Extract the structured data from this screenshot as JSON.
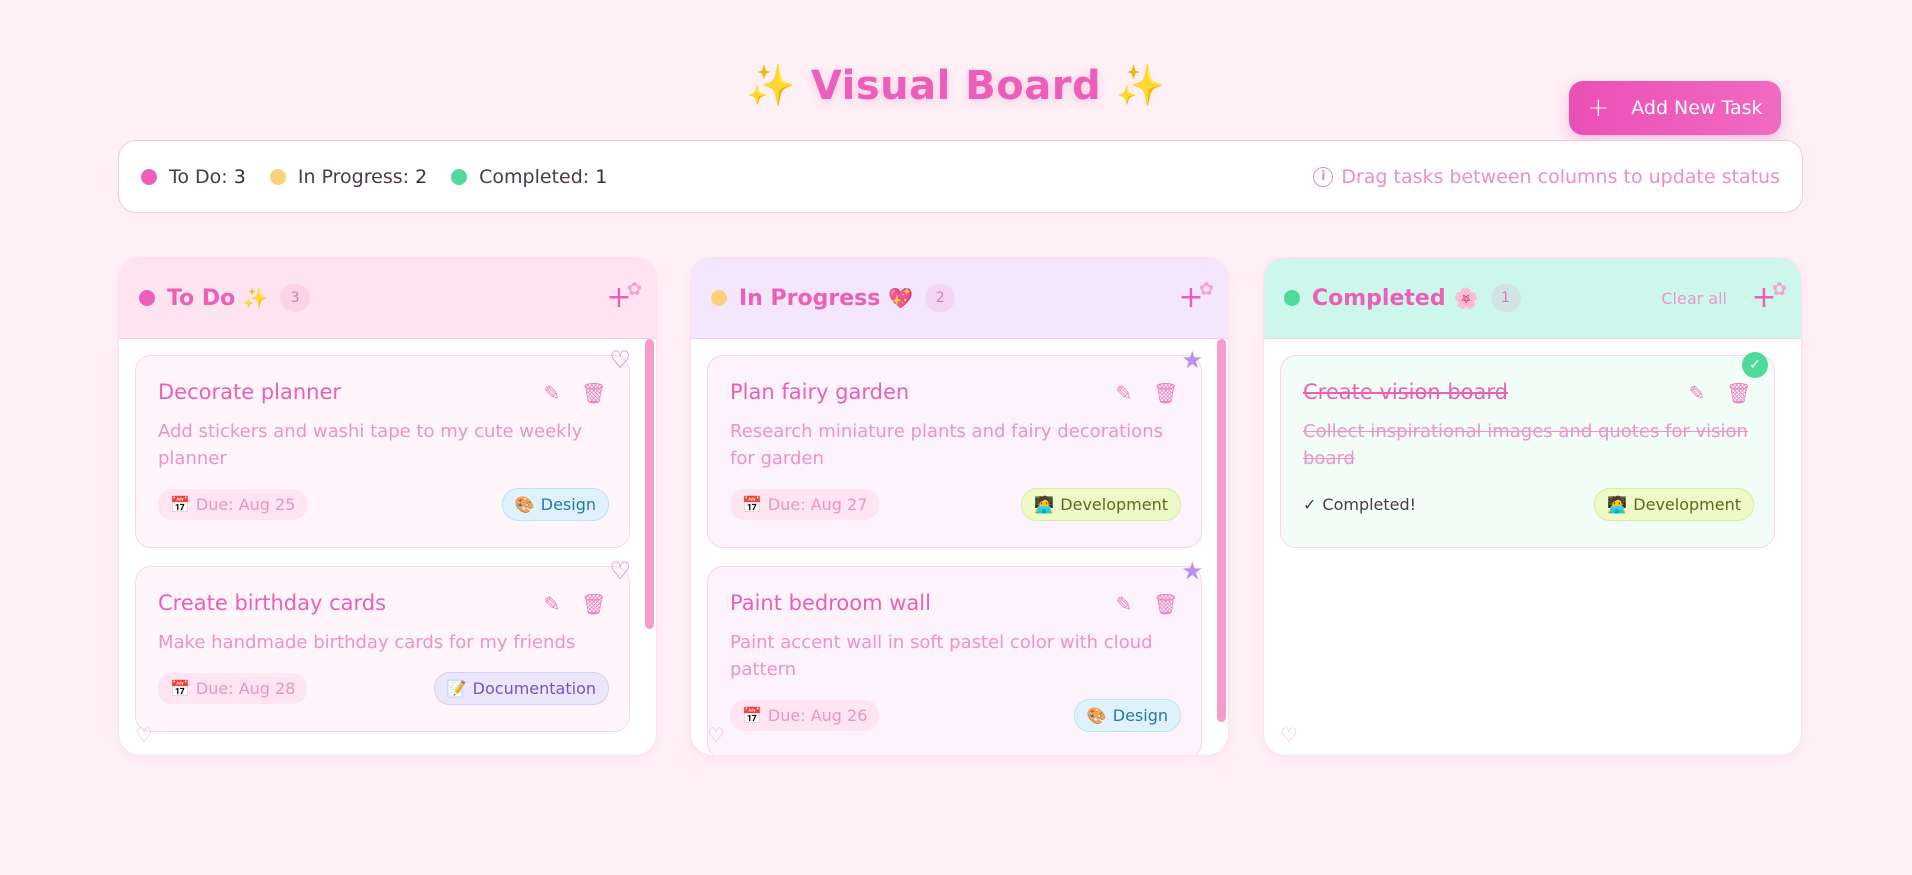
{
  "header": {
    "title": "Visual Board",
    "sparkle": "✨",
    "add_button_label": "Add New Task",
    "add_button_icon": "plus-icon"
  },
  "stats": {
    "todo_label": "To Do:",
    "todo_count": "3",
    "progress_label": "In Progress:",
    "progress_count": "2",
    "done_label": "Completed:",
    "done_count": "1",
    "hint": "Drag tasks between columns to update status",
    "colors": {
      "todo": "#ec5fb8",
      "progress": "#fbd27a",
      "done": "#4fd99b"
    }
  },
  "columns": [
    {
      "title": "To Do",
      "emoji": "✨",
      "count": "3",
      "head_bg": "#fde4f0",
      "cards": [
        {
          "title": "Decorate planner",
          "desc": "Add stickers and washi tape to my cute weekly planner",
          "due": "Due: Aug 25",
          "tag": "Design",
          "tag_icon": "🎨",
          "badge": "heart-icon"
        },
        {
          "title": "Create birthday cards",
          "desc": "Make handmade birthday cards for my friends",
          "due": "Due: Aug 28",
          "tag": "Documentation",
          "tag_icon": "📝",
          "badge": "heart-icon"
        }
      ]
    },
    {
      "title": "In Progress",
      "emoji": "💖",
      "count": "2",
      "head_bg": "#f3e6fd",
      "cards": [
        {
          "title": "Plan fairy garden",
          "desc": "Research miniature plants and fairy decorations for garden",
          "due": "Due: Aug 27",
          "tag": "Development",
          "tag_icon": "🧑‍💻",
          "badge": "star-icon"
        },
        {
          "title": "Paint bedroom wall",
          "desc": "Paint accent wall in soft pastel color with cloud pattern",
          "due": "Due: Aug 26",
          "tag": "Design",
          "tag_icon": "🎨",
          "badge": "star-icon"
        }
      ]
    },
    {
      "title": "Completed",
      "emoji": "🌸",
      "count": "1",
      "head_bg": "#ccf7ea",
      "clear_label": "Clear all",
      "cards": [
        {
          "title": "Create vision board",
          "desc": "Collect inspirational images and quotes for vision board",
          "status": "Completed!",
          "tag": "Development",
          "tag_icon": "🧑‍💻",
          "badge": "check-icon"
        }
      ]
    }
  ]
}
